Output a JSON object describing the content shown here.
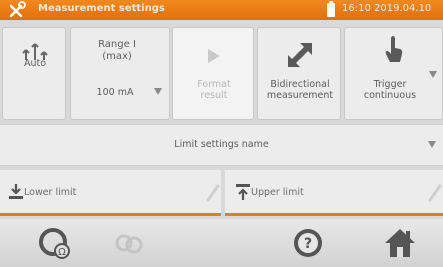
{
  "titlebar": {
    "title": "Measurement settings",
    "clock": "16:10 2019.04.10"
  },
  "panels": {
    "auto": {
      "label": "Auto"
    },
    "range": {
      "label_line1": "Range I",
      "label_line2": "(max)",
      "value": "100 mA"
    },
    "format": {
      "label_line1": "Format",
      "label_line2": "result"
    },
    "bidirectional": {
      "label_line1": "Bidirectional",
      "label_line2": "measurement"
    },
    "trigger": {
      "label_line1": "Trigger",
      "label_line2": "continuous"
    }
  },
  "limits": {
    "settings_name": "Limit settings name",
    "lower_placeholder": "Lower limit",
    "upper_placeholder": "Upper limit"
  },
  "colors": {
    "accent": "#f07a12",
    "titlebar": "#e9780f"
  }
}
